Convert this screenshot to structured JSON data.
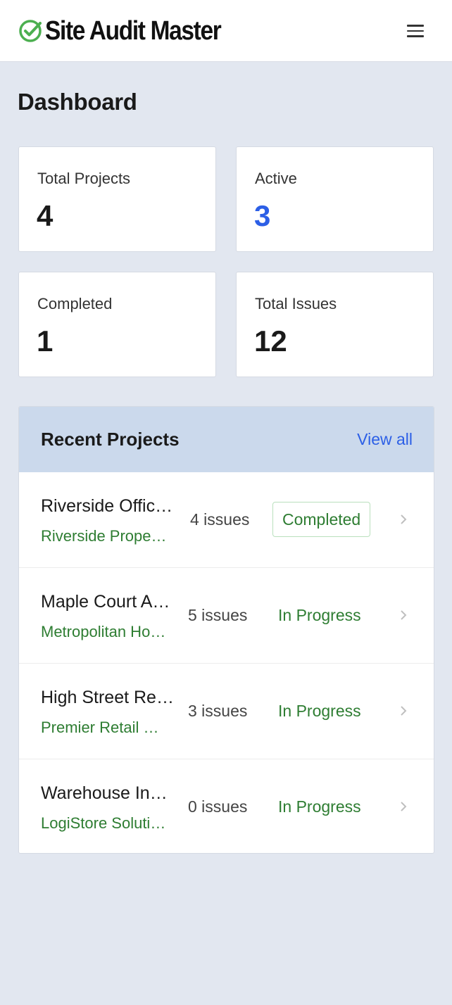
{
  "header": {
    "app_name": "Site Audit Master",
    "logo_icon": "check-circle-icon",
    "menu_icon": "hamburger-menu-icon",
    "accent_color": "#4caf50"
  },
  "page": {
    "title": "Dashboard"
  },
  "stats": [
    {
      "label": "Total Projects",
      "value": "4"
    },
    {
      "label": "Active",
      "value": "3",
      "color": "#2c5fe6"
    },
    {
      "label": "Completed",
      "value": "1"
    },
    {
      "label": "Total Issues",
      "value": "12"
    }
  ],
  "recent": {
    "title": "Recent Projects",
    "view_all": "View all",
    "projects": [
      {
        "name": "Riverside Office Complex",
        "client": "Riverside Properties",
        "issues": "4 issues",
        "status": "Completed"
      },
      {
        "name": "Maple Court Apartments",
        "client": "Metropolitan Housing",
        "issues": "5 issues",
        "status": "In Progress"
      },
      {
        "name": "High Street Retail Park",
        "client": "Premier Retail Group",
        "issues": "3 issues",
        "status": "In Progress"
      },
      {
        "name": "Warehouse Inspection",
        "client": "LogiStore Solutions",
        "issues": "0 issues",
        "status": "In Progress"
      }
    ]
  },
  "colors": {
    "status_green": "#2e7d32",
    "link_blue": "#2c5fe6",
    "panel_header": "#cbd9ec",
    "background": "#e2e7f0"
  }
}
